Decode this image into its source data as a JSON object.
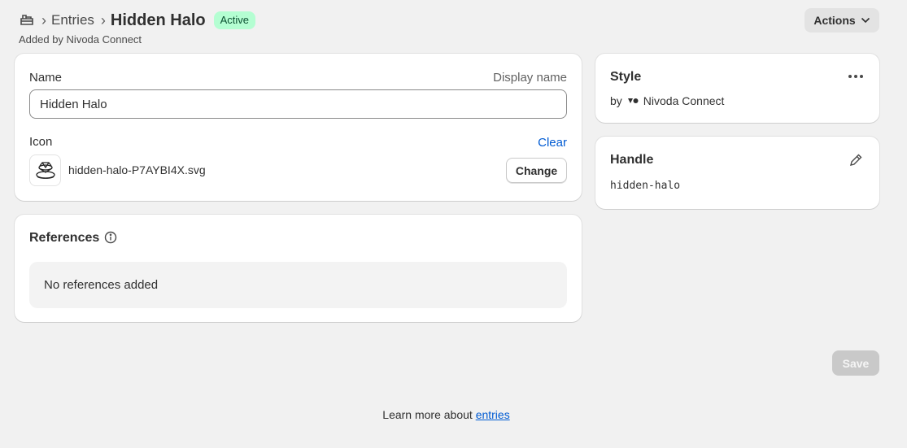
{
  "breadcrumb": {
    "icon": "store-icon",
    "parent": "Entries",
    "title": "Hidden Halo",
    "status": "Active",
    "subtitle": "Added by Nivoda Connect"
  },
  "header": {
    "actions_label": "Actions"
  },
  "main_card": {
    "name_label": "Name",
    "name_hint": "Display name",
    "name_value": "Hidden Halo",
    "icon_label": "Icon",
    "clear_label": "Clear",
    "file_name": "hidden-halo-P7AYBI4X.svg",
    "change_label": "Change"
  },
  "references": {
    "title": "References",
    "empty_text": "No references added"
  },
  "style_card": {
    "title": "Style",
    "by_prefix": "by",
    "app_name": "Nivoda Connect"
  },
  "handle_card": {
    "title": "Handle",
    "value": "hidden-halo"
  },
  "save_label": "Save",
  "footer": {
    "prefix": "Learn more about ",
    "link": "entries"
  },
  "colors": {
    "accent_link": "#005bd3",
    "badge_bg": "#b4fed2",
    "badge_text": "#0c5132",
    "background": "#f1f1f1"
  }
}
